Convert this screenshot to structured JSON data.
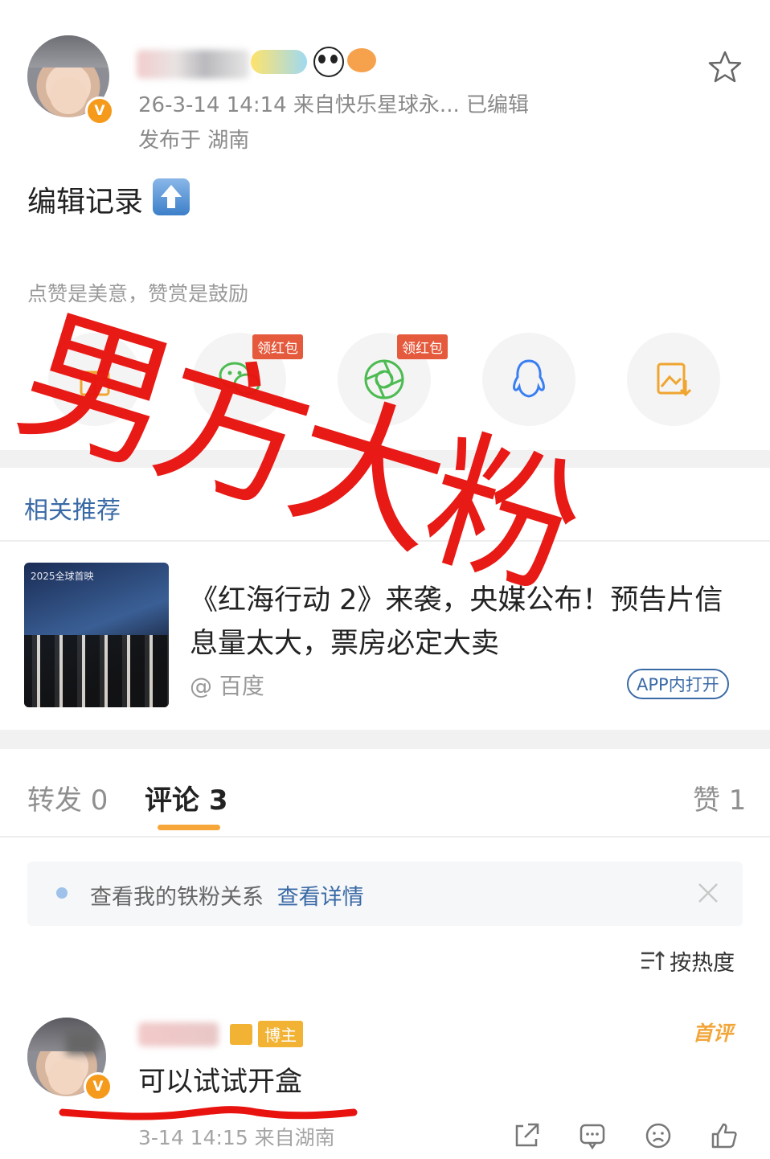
{
  "post": {
    "meta_line": "26-3-14 14:14  来自快乐星球永...  已编辑",
    "location_line": "发布于 湖南",
    "body_text": "编辑记录",
    "reward_hint": "点赞是美意，赞赏是鼓励"
  },
  "share": {
    "redpack_label_1": "领红包",
    "redpack_label_2": "领红包"
  },
  "overlay": {
    "stamp_text": "男方大粉"
  },
  "related": {
    "heading": "相关推荐",
    "card_title": "《红海行动 2》来袭，央媒公布！预告片信息量太大，票房必定大卖",
    "card_source": "@ 百度",
    "open_app_label": "APP内打开",
    "thumb_caption": "2025全球首映"
  },
  "tabs": {
    "repost": "转发 0",
    "comments": "评论 3",
    "likes": "赞 1"
  },
  "notice": {
    "text": "查看我的铁粉关系",
    "link": "查看详情"
  },
  "sort": {
    "label": "按热度"
  },
  "comment": {
    "author_badge": "博主",
    "first_tag": "首评",
    "text": "可以试试开盒",
    "meta": "3-14 14:15  来自湖南"
  },
  "colors": {
    "accent_blue": "#3a6aa6",
    "stamp_red": "#e8130f",
    "tab_underline": "#f7a63a"
  }
}
